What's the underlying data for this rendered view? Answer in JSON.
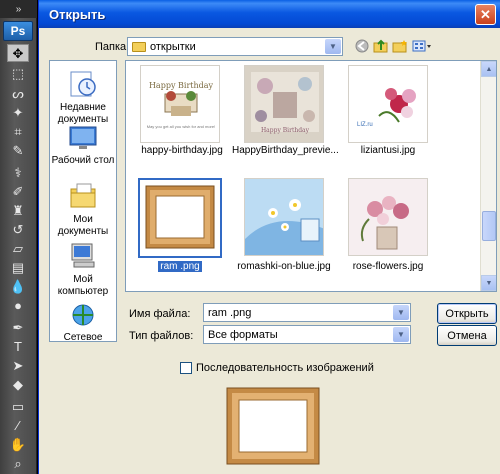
{
  "photoshop": {
    "logo": "Ps",
    "menu_glyph": "»",
    "tools": [
      "move-tool",
      "marquee-tool",
      "lasso-tool",
      "magic-wand-tool",
      "crop-tool",
      "slice-tool",
      "healing-brush-tool",
      "brush-tool",
      "clone-stamp-tool",
      "history-brush-tool",
      "eraser-tool",
      "gradient-tool",
      "blur-tool",
      "dodge-tool",
      "pen-tool",
      "type-tool",
      "path-selection-tool",
      "shape-tool",
      "notes-tool",
      "eyedropper-tool",
      "hand-tool",
      "zoom-tool"
    ]
  },
  "dialog": {
    "title": "Открыть",
    "close_glyph": "✕",
    "folder_label": "Папка:",
    "folder_value": "открытки",
    "toolbar": [
      "back-icon",
      "up-folder-icon",
      "new-folder-icon",
      "view-menu-icon"
    ],
    "places": [
      {
        "label": "Недавние документы",
        "icon": "recent-documents-icon"
      },
      {
        "label": "Рабочий стол",
        "icon": "desktop-icon"
      },
      {
        "label": "Мои документы",
        "icon": "my-documents-icon"
      },
      {
        "label": "Мой компьютер",
        "icon": "my-computer-icon"
      },
      {
        "label": "Сетевое",
        "icon": "network-icon"
      }
    ],
    "files": [
      {
        "name": "happy-birthday.jpg",
        "thumb_text": "Happy Birthday"
      },
      {
        "name": "HappyBirthday_previe...",
        "thumb_text": "Happy Birthday"
      },
      {
        "name": "liziantusi.jpg",
        "thumb_text": "LIZ.ru"
      },
      {
        "name": "ram .png",
        "selected": true
      },
      {
        "name": "romashki-on-blue.jpg"
      },
      {
        "name": "rose-flowers.jpg"
      }
    ],
    "filename_label": "Имя файла:",
    "filename_value": "ram .png",
    "filetype_label": "Тип файлов:",
    "filetype_value": "Все форматы",
    "open_button": "Открыть",
    "cancel_button": "Отмена",
    "sequence_label": "Последовательность изображений",
    "sequence_checked": false
  },
  "colors": {
    "title_bar": "#0a58e1",
    "dialog_bg": "#ece9d8",
    "selection": "#316ac5",
    "frame_wood": "#c48a45"
  }
}
